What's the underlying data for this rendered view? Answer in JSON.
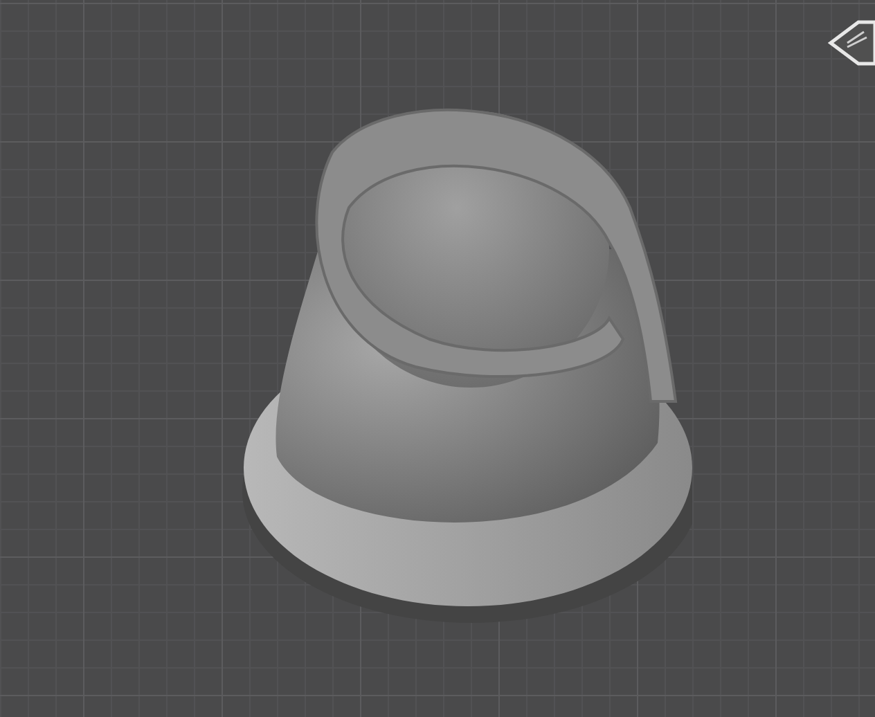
{
  "viewport": {
    "kind": "build-plate"
  }
}
